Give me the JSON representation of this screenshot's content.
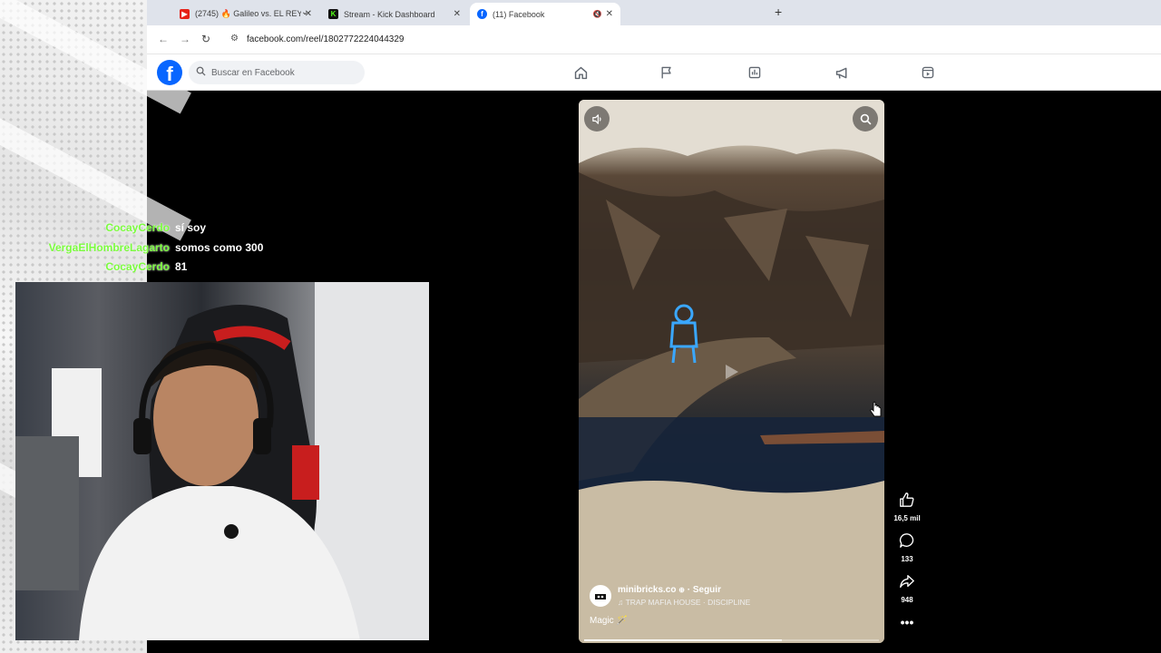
{
  "browser": {
    "tabs": [
      {
        "label": "(2745) 🔥 Galileo vs. EL REY PE",
        "favicon": "youtube-icon",
        "active": false
      },
      {
        "label": "Stream - Kick Dashboard",
        "favicon": "kick-icon",
        "active": false
      },
      {
        "label": "(11) Facebook",
        "favicon": "facebook-icon",
        "active": true
      }
    ],
    "url": "facebook.com/reel/1802772224044329"
  },
  "facebook": {
    "search_placeholder": "Buscar en Facebook",
    "nav": [
      "home-icon",
      "pages-flag-icon",
      "dashboard-icon",
      "ads-megaphone-icon",
      "reels-icon"
    ],
    "brand_color": "#0866ff"
  },
  "chat": [
    {
      "user": "CocayCerdo",
      "message": "sí soy"
    },
    {
      "user": "VergaElHombreLagarto",
      "message": "somos como 300"
    },
    {
      "user": "CocayCerdo",
      "message": "81"
    }
  ],
  "reel": {
    "channel": "minibricks.co",
    "follow": "· Seguir",
    "music": "♫ TRAP MAFIA HOUSE · DISCIPLINE",
    "caption": "Magic 🪄",
    "likes": "16,5 mil",
    "comments": "133",
    "shares": "948",
    "progress": 0.67
  }
}
